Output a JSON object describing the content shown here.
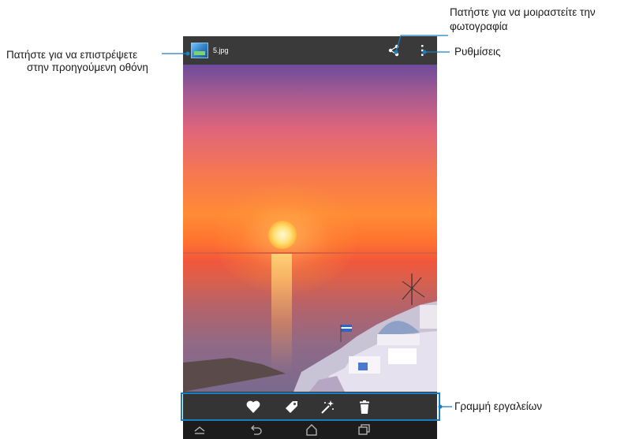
{
  "app": {
    "filename": "5.jpg"
  },
  "callouts": {
    "back_line1": "Πατήστε για να επιστρέψετε",
    "back_line2": "στην προηγούμενη οθόνη",
    "share_line1": "Πατήστε για να μοιραστείτε την",
    "share_line2": "φωτογραφία",
    "settings": "Ρυθμίσεις",
    "toolbar": "Γραμμή εργαλείων"
  },
  "toolbar": {
    "items": [
      "heart-icon",
      "tag-icon",
      "magic-wand-icon",
      "trash-icon"
    ]
  },
  "navbar": {
    "items": [
      "chevron-up-icon",
      "back-icon",
      "home-icon",
      "recent-apps-icon"
    ]
  },
  "colors": {
    "callout": "#1a7fc1",
    "topbar": "#3a3a3a",
    "navbar": "#1c1c1c"
  }
}
